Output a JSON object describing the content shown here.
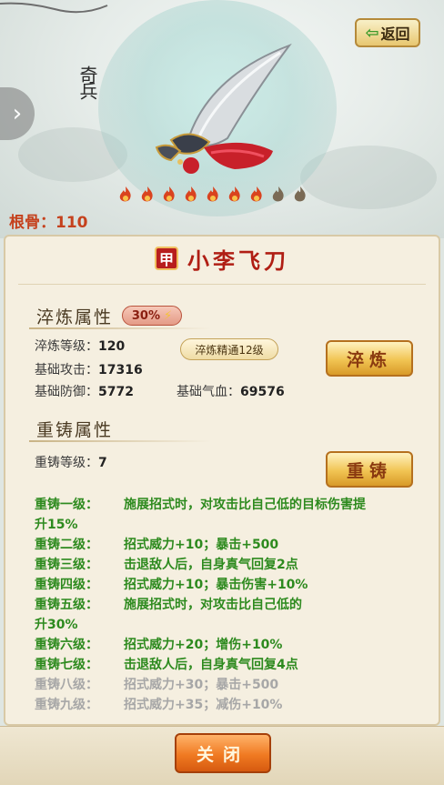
{
  "header": {
    "back_label": "返回",
    "brush_title": "奇兵",
    "root_bone_label": "根骨：110",
    "flames": {
      "lit": 7,
      "total": 9,
      "lit_color": "#d9431f",
      "dim_color": "#7a6a55"
    }
  },
  "panel": {
    "badge": "甲",
    "weapon_name": "小李飞刀",
    "temper": {
      "heading": "淬炼属性",
      "percent": "30%",
      "level_label": "淬炼等级：",
      "level_value": "120",
      "mastery": "淬炼精通12级",
      "attack_label": "基础攻击：",
      "attack_value": "17316",
      "defense_label": "基础防御：",
      "defense_value": "5772",
      "hp_label": "基础气血：",
      "hp_value": "69576",
      "button": "淬炼"
    },
    "recast": {
      "heading": "重铸属性",
      "level_label": "重铸等级：",
      "level_value": "7",
      "button": "重铸",
      "effects": [
        {
          "level": "重铸一级：",
          "text": "施展招式时，对攻击比自己低的目标伤害提",
          "cont": "升15%",
          "active": true
        },
        {
          "level": "重铸二级：",
          "text": "招式威力+10；暴击+500",
          "active": true
        },
        {
          "level": "重铸三级：",
          "text": "击退敌人后，自身真气回复2点",
          "active": true
        },
        {
          "level": "重铸四级：",
          "text": "招式威力+10；暴击伤害+10%",
          "active": true
        },
        {
          "level": "重铸五级：",
          "text": "施展招式时，对攻击比自己低的",
          "cont": "升30%",
          "active": true
        },
        {
          "level": "重铸六级：",
          "text": "招式威力+20；增伤+10%",
          "active": true
        },
        {
          "level": "重铸七级：",
          "text": "击退敌人后，自身真气回复4点",
          "active": true
        },
        {
          "level": "重铸八级：",
          "text": "招式威力+30；暴击+500",
          "active": false
        },
        {
          "level": "重铸九级：",
          "text": "招式威力+35；减伤+10%",
          "active": false
        }
      ]
    }
  },
  "footer": {
    "close_label": "关闭"
  },
  "colors": {
    "green_effect": "#2d8a1e",
    "inactive_effect": "#a7a7a7",
    "title_red": "#b01e14"
  }
}
